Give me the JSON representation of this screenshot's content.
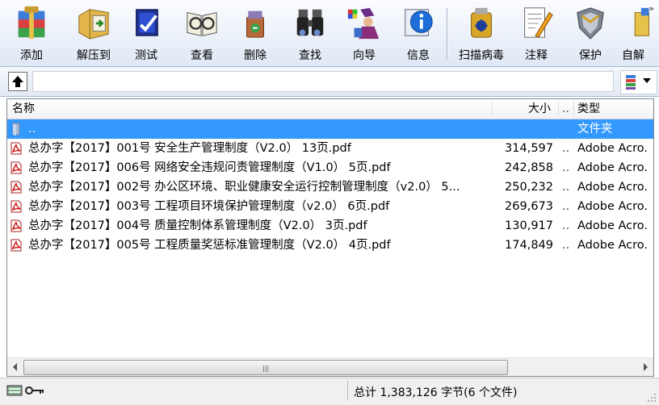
{
  "toolbar": {
    "buttons": [
      {
        "label": "添加",
        "icon": "add-archive-icon"
      },
      {
        "label": "解压到",
        "icon": "extract-icon"
      },
      {
        "label": "测试",
        "icon": "test-icon"
      },
      {
        "label": "查看",
        "icon": "view-icon"
      },
      {
        "label": "删除",
        "icon": "delete-icon"
      },
      {
        "label": "查找",
        "icon": "find-icon"
      },
      {
        "label": "向导",
        "icon": "wizard-icon"
      },
      {
        "label": "信息",
        "icon": "info-icon"
      },
      {
        "label": "扫描病毒",
        "icon": "virus-scan-icon"
      },
      {
        "label": "注释",
        "icon": "comment-icon"
      },
      {
        "label": "保护",
        "icon": "protect-icon"
      },
      {
        "label": "自解",
        "icon": "sfx-icon"
      }
    ],
    "more": "»"
  },
  "columns": {
    "name": "名称",
    "size": "大小",
    "dots": "..",
    "type": "类型"
  },
  "files": [
    {
      "name": "..",
      "size": "",
      "dots": "",
      "type": "文件夹",
      "kind": "folder"
    },
    {
      "name": "总办字【2017】001号 安全生产管理制度（V2.0） 13页.pdf",
      "size": "314,597",
      "dots": "..",
      "type": "Adobe Acro.",
      "kind": "pdf"
    },
    {
      "name": "总办字【2017】006号 网络安全违规问责管理制度（V1.0） 5页.pdf",
      "size": "242,858",
      "dots": "..",
      "type": "Adobe Acro.",
      "kind": "pdf"
    },
    {
      "name": "总办字【2017】002号 办公区环境、职业健康安全运行控制管理制度（v2.0） 5...",
      "size": "250,232",
      "dots": "..",
      "type": "Adobe Acro.",
      "kind": "pdf"
    },
    {
      "name": "总办字【2017】003号 工程项目环境保护管理制度（v2.0） 6页.pdf",
      "size": "269,673",
      "dots": "..",
      "type": "Adobe Acro.",
      "kind": "pdf"
    },
    {
      "name": "总办字【2017】004号 质量控制体系管理制度（V2.0） 3页.pdf",
      "size": "130,917",
      "dots": "..",
      "type": "Adobe Acro.",
      "kind": "pdf"
    },
    {
      "name": "总办字【2017】005号 工程质量奖惩标准管理制度（V2.0） 4页.pdf",
      "size": "174,849",
      "dots": "..",
      "type": "Adobe Acro.",
      "kind": "pdf"
    }
  ],
  "scrollbar": {
    "grip": "|||"
  },
  "status": {
    "summary": "总计 1,383,126 字节(6 个文件)"
  },
  "colors": {
    "selection": "#3399ff",
    "accent": "#1f4e9b"
  }
}
